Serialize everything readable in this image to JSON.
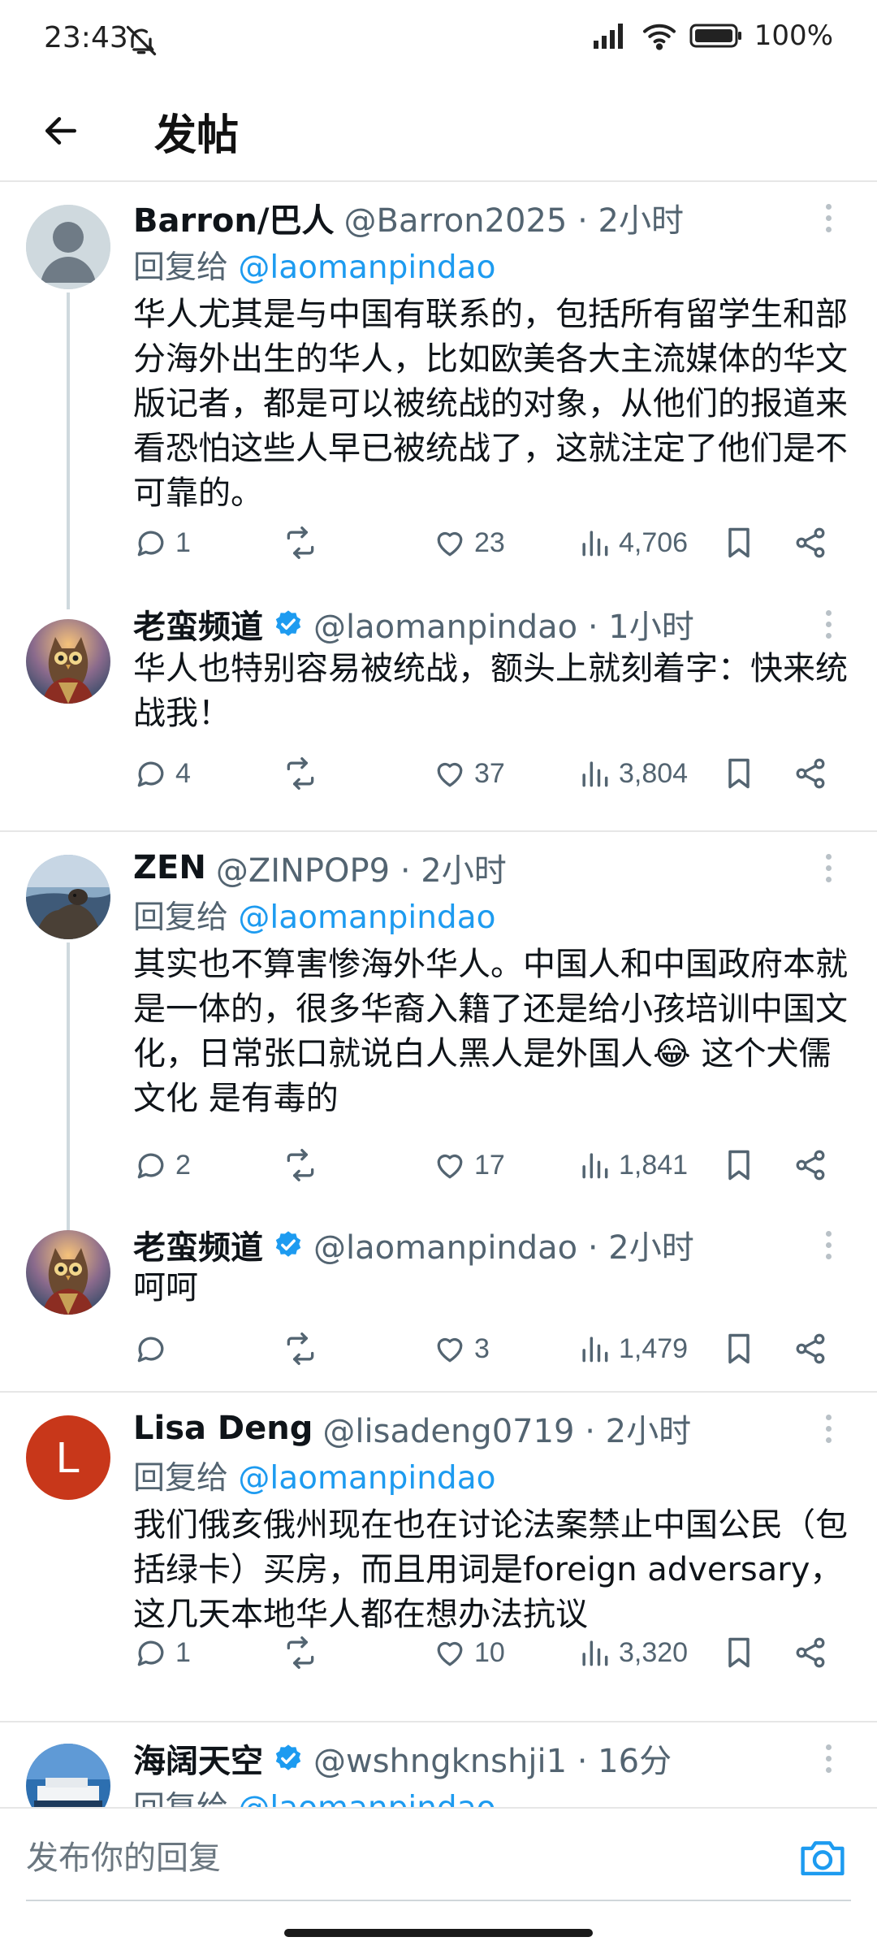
{
  "status_bar": {
    "time": "23:43",
    "battery": "100%"
  },
  "header": {
    "title": "发帖"
  },
  "reply_label": "回复给",
  "posts": [
    {
      "name": "Barron/巴人",
      "handle": "@Barron2025 · 2小时",
      "reply_to": "@laomanpindao",
      "text": "华人尤其是与中国有联系的，包括所有留学生和部分海外出生的华人，比如欧美各大主流媒体的华文版记者，都是可以被统战的对象，从他们的报道来看恐怕这些人早已被统战了，这就注定了他们是不可靠的。",
      "replies": "1",
      "retweets": "",
      "likes": "23",
      "views": "4,706"
    },
    {
      "name": "老蛮频道",
      "handle": "@laomanpindao · 1小时",
      "text": "华人也特别容易被统战，额头上就刻着字：快来统战我！",
      "replies": "4",
      "retweets": "",
      "likes": "37",
      "views": "3,804"
    },
    {
      "name": "ZEN",
      "handle": "@ZINPOP9 · 2小时",
      "reply_to": "@laomanpindao",
      "text": "其实也不算害惨海外华人。中国人和中国政府本就是一体的，很多华裔入籍了还是给小孩培训中国文化，日常张口就说白人黑人是外国人😂 这个犬儒文化 是有毒的",
      "replies": "2",
      "retweets": "",
      "likes": "17",
      "views": "1,841"
    },
    {
      "name": "老蛮频道",
      "handle": "@laomanpindao · 2小时",
      "text": "呵呵",
      "replies": "",
      "retweets": "",
      "likes": "3",
      "views": "1,479"
    },
    {
      "name": "Lisa Deng",
      "handle": "@lisadeng0719 · 2小时",
      "reply_to": "@laomanpindao",
      "avatar_letter": "L",
      "text": "我们俄亥俄州现在也在讨论法案禁止中国公民（包括绿卡）买房，而且用词是foreign adversary，这几天本地华人都在想办法抗议",
      "replies": "1",
      "retweets": "",
      "likes": "10",
      "views": "3,320"
    },
    {
      "name": "海阔天空",
      "handle": "@wshngknshji1 · 16分",
      "reply_to": "@laomanpindao"
    }
  ],
  "reply_bar": {
    "placeholder": "发布你的回复"
  },
  "colors": {
    "accent": "#1d9bf0",
    "secondary_text": "#536471",
    "thread_line": "#cfd9de",
    "lisa_avatar": "#c8371a"
  }
}
